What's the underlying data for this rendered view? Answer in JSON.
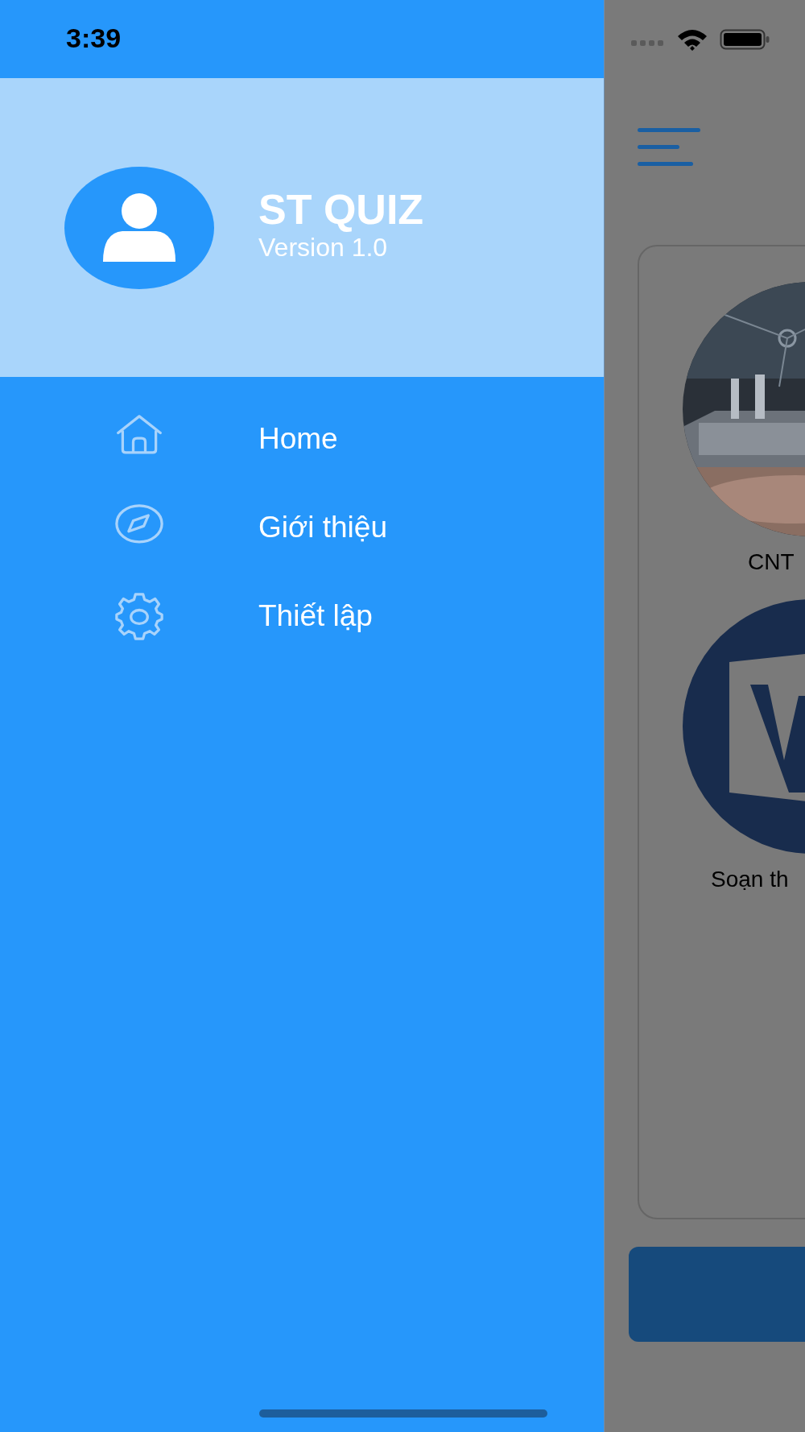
{
  "status_bar": {
    "time": "3:39"
  },
  "drawer": {
    "app_title": "ST QUIZ",
    "version": "Version 1.0",
    "items": [
      {
        "label": "Home"
      },
      {
        "label": "Giới thiệu"
      },
      {
        "label": "Thiết lập"
      }
    ]
  },
  "main": {
    "categories": [
      {
        "kind": "picture",
        "label": "CNT"
      },
      {
        "kind": "logo",
        "label": "Soạn th"
      }
    ]
  }
}
